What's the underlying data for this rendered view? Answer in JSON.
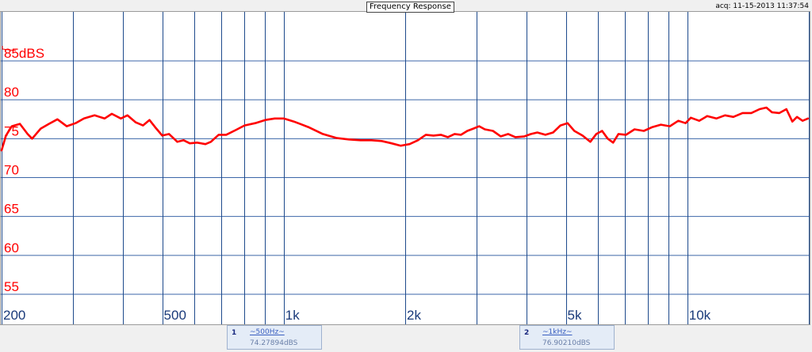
{
  "window": {
    "title": "Frequency Response",
    "acq": "acq: 11-15-2013 11:37:54"
  },
  "cursors": [
    {
      "index": "1",
      "freq": "~500Hz~",
      "value": "74.27894dBS"
    },
    {
      "index": "2",
      "freq": "~1kHz~",
      "value": "76.90210dBS"
    }
  ],
  "colors": {
    "trace": "#ff0000",
    "grid_vertical": "#1e4a8c",
    "grid_horizontal": "#3b66a8",
    "axis_label": "#ff0000",
    "x_label": "#1a3a7a"
  },
  "chart_data": {
    "type": "line",
    "title": "Frequency Response",
    "xscale": "log",
    "xlim": [
      200,
      20000
    ],
    "ylim": [
      55,
      85
    ],
    "yunit": "dBS",
    "grid": true,
    "x_ticks": [
      {
        "value": 200,
        "label": "200"
      },
      {
        "value": 500,
        "label": "500"
      },
      {
        "value": 1000,
        "label": "1k"
      },
      {
        "value": 2000,
        "label": "2k"
      },
      {
        "value": 5000,
        "label": "5k"
      },
      {
        "value": 10000,
        "label": "10k"
      }
    ],
    "x_gridlines": [
      200,
      300,
      400,
      500,
      600,
      700,
      800,
      900,
      1000,
      2000,
      3000,
      4000,
      5000,
      6000,
      7000,
      8000,
      9000,
      10000,
      20000
    ],
    "y_ticks": [
      {
        "value": 85,
        "label": "85dBS"
      },
      {
        "value": 80,
        "label": "80"
      },
      {
        "value": 75,
        "label": "75"
      },
      {
        "value": 70,
        "label": "70"
      },
      {
        "value": 65,
        "label": "65"
      },
      {
        "value": 60,
        "label": "60"
      },
      {
        "value": 55,
        "label": "55"
      }
    ],
    "series": [
      {
        "points": [
          [
            200,
            73.5
          ],
          [
            205,
            75.4
          ],
          [
            212,
            76.6
          ],
          [
            222,
            76.9
          ],
          [
            232,
            75.6
          ],
          [
            238,
            75.0
          ],
          [
            250,
            76.3
          ],
          [
            262,
            76.9
          ],
          [
            275,
            77.5
          ],
          [
            290,
            76.6
          ],
          [
            305,
            77.0
          ],
          [
            320,
            77.6
          ],
          [
            340,
            78.0
          ],
          [
            360,
            77.6
          ],
          [
            375,
            78.2
          ],
          [
            395,
            77.6
          ],
          [
            410,
            78.0
          ],
          [
            430,
            77.1
          ],
          [
            448,
            76.7
          ],
          [
            465,
            77.4
          ],
          [
            480,
            76.5
          ],
          [
            500,
            75.4
          ],
          [
            520,
            75.6
          ],
          [
            545,
            74.6
          ],
          [
            565,
            74.8
          ],
          [
            585,
            74.4
          ],
          [
            610,
            74.5
          ],
          [
            640,
            74.3
          ],
          [
            660,
            74.6
          ],
          [
            690,
            75.5
          ],
          [
            720,
            75.5
          ],
          [
            760,
            76.1
          ],
          [
            800,
            76.7
          ],
          [
            850,
            77.0
          ],
          [
            900,
            77.4
          ],
          [
            950,
            77.6
          ],
          [
            1000,
            77.6
          ],
          [
            1060,
            77.2
          ],
          [
            1150,
            76.5
          ],
          [
            1250,
            75.6
          ],
          [
            1350,
            75.1
          ],
          [
            1450,
            74.9
          ],
          [
            1550,
            74.8
          ],
          [
            1650,
            74.8
          ],
          [
            1750,
            74.7
          ],
          [
            1850,
            74.4
          ],
          [
            1950,
            74.1
          ],
          [
            2050,
            74.3
          ],
          [
            2150,
            74.8
          ],
          [
            2250,
            75.5
          ],
          [
            2350,
            75.4
          ],
          [
            2450,
            75.5
          ],
          [
            2550,
            75.2
          ],
          [
            2650,
            75.6
          ],
          [
            2750,
            75.5
          ],
          [
            2850,
            76.0
          ],
          [
            2950,
            76.3
          ],
          [
            3050,
            76.6
          ],
          [
            3150,
            76.2
          ],
          [
            3300,
            76.0
          ],
          [
            3450,
            75.3
          ],
          [
            3600,
            75.6
          ],
          [
            3750,
            75.2
          ],
          [
            3950,
            75.3
          ],
          [
            4100,
            75.6
          ],
          [
            4250,
            75.8
          ],
          [
            4450,
            75.5
          ],
          [
            4650,
            75.8
          ],
          [
            4850,
            76.7
          ],
          [
            5050,
            77.0
          ],
          [
            5250,
            76.0
          ],
          [
            5500,
            75.4
          ],
          [
            5750,
            74.6
          ],
          [
            5950,
            75.6
          ],
          [
            6150,
            76.0
          ],
          [
            6350,
            75.0
          ],
          [
            6550,
            74.5
          ],
          [
            6750,
            75.6
          ],
          [
            7050,
            75.5
          ],
          [
            7400,
            76.2
          ],
          [
            7800,
            76.0
          ],
          [
            8200,
            76.5
          ],
          [
            8600,
            76.8
          ],
          [
            9050,
            76.6
          ],
          [
            9500,
            77.3
          ],
          [
            9900,
            77.0
          ],
          [
            10200,
            77.7
          ],
          [
            10700,
            77.3
          ],
          [
            11200,
            77.9
          ],
          [
            11800,
            77.6
          ],
          [
            12400,
            78.0
          ],
          [
            13000,
            77.8
          ],
          [
            13700,
            78.3
          ],
          [
            14400,
            78.3
          ],
          [
            15100,
            78.8
          ],
          [
            15700,
            79.0
          ],
          [
            16200,
            78.4
          ],
          [
            16900,
            78.3
          ],
          [
            17600,
            78.8
          ],
          [
            18200,
            77.2
          ],
          [
            18700,
            77.8
          ],
          [
            19300,
            77.3
          ],
          [
            19900,
            77.6
          ]
        ]
      }
    ]
  }
}
